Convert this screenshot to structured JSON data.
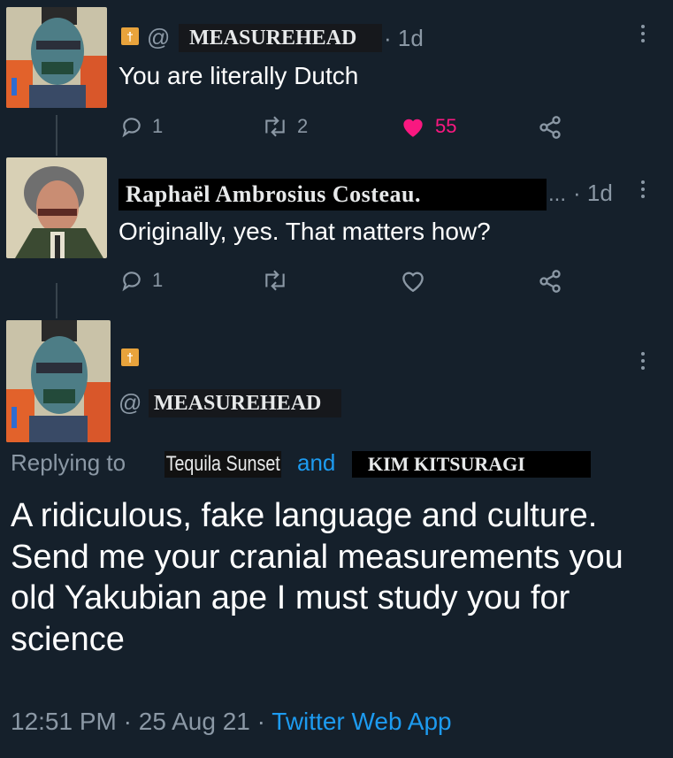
{
  "tweet1": {
    "badge_glyph": "†",
    "at_sign": "@",
    "handle": "MEASUREHEAD",
    "time": "· 1d",
    "text": "You are literally Dutch",
    "replies": "1",
    "retweets": "2",
    "likes": "55",
    "liked": true
  },
  "tweet2": {
    "name": "Raphaël Ambrosius Costeau.",
    "ellipsis": "...",
    "time": "· 1d",
    "text": "Originally, yes. That matters how?",
    "replies": "1"
  },
  "main_tweet": {
    "badge_glyph": "†",
    "at_sign": "@",
    "handle": "MEASUREHEAD",
    "replying_to": "Replying to",
    "reply_user1": "Tequila Sunset",
    "and": "and",
    "reply_user2": "KIM KITSURAGI",
    "text": "A ridiculous, fake language and culture. Send me your cranial measurements you old Yakubian ape I must study you for science",
    "time": "12:51 PM",
    "sep1": "·",
    "date": "25 Aug 21",
    "sep2": "·",
    "source": "Twitter Web App"
  },
  "colors": {
    "background": "#15202b",
    "muted": "#8b98a5",
    "link": "#1d9bf0",
    "like": "#f91880",
    "badge": "#e8a33c"
  },
  "icons": {
    "reply": "reply-icon",
    "retweet": "retweet-icon",
    "like": "heart-icon",
    "share": "share-icon",
    "more": "more-icon"
  }
}
